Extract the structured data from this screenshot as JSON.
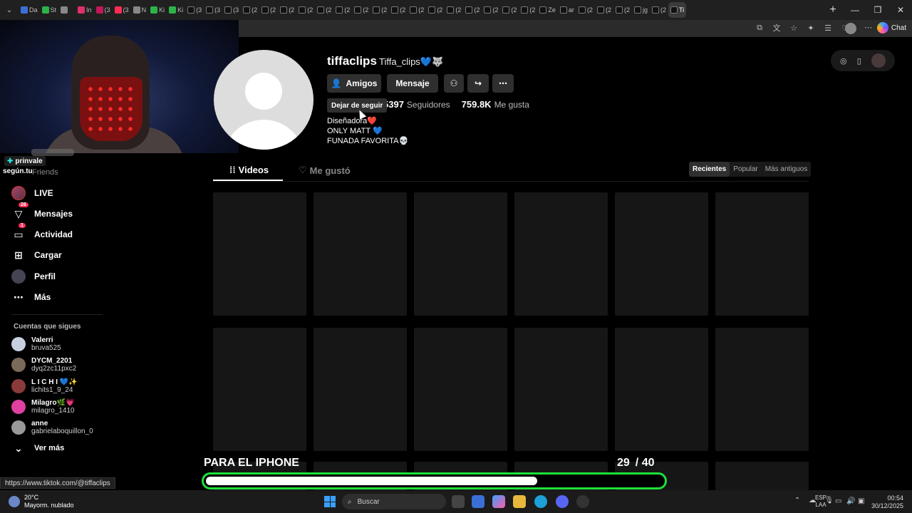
{
  "browser": {
    "tabs": [
      "Da",
      "St",
      "",
      "In",
      "(3",
      "(3",
      "N",
      "Ki",
      "Ki",
      "(3",
      "(3",
      "(3",
      "(2",
      "(2",
      "(2",
      "(2",
      "(2",
      "(2",
      "(2",
      "(2",
      "(2",
      "(2",
      "(2",
      "(2",
      "(2",
      "(2",
      "(2",
      "(2",
      "Ze",
      "ar",
      "(2",
      "(2",
      "(2",
      "jg",
      "(2",
      "Ti"
    ],
    "copilot_label": "Chat"
  },
  "sidebar": {
    "badge": "prinvale",
    "sub": "según.tu",
    "friends": "Friends",
    "items": [
      {
        "label": "LIVE",
        "icon": "live-avatar-icon"
      },
      {
        "label": "Mensajes",
        "icon": "messages-icon",
        "count": "26"
      },
      {
        "label": "Actividad",
        "icon": "activity-icon",
        "count": "1"
      },
      {
        "label": "Cargar",
        "icon": "upload-icon"
      },
      {
        "label": "Perfil",
        "icon": "profile-icon"
      },
      {
        "label": "Más",
        "icon": "more-icon"
      }
    ],
    "following_heading": "Cuentas que sigues",
    "accounts": [
      {
        "name": "Valerri",
        "handle": "bruva525",
        "color": "#c8d0e0"
      },
      {
        "name": "DYCM_2201",
        "handle": "dyq2zc11pxc2",
        "color": "#7a6a5a"
      },
      {
        "name": "L I C H I 💙✨",
        "handle": "lichits1_9_24",
        "color": "#8a3a3a"
      },
      {
        "name": "Milagro🌿💗",
        "handle": "milagro_1410",
        "color": "#e040a0"
      },
      {
        "name": "anne",
        "handle": "gabrielaboquillon_0",
        "color": "#999999"
      }
    ],
    "see_more": "Ver más"
  },
  "profile": {
    "username": "tiffaclips",
    "nickname": "Tiffa_clips💙🐺",
    "buttons": {
      "friends": "Amigos",
      "message": "Mensaje"
    },
    "tooltip": "Dejar de seguir",
    "followers_value": "5397",
    "followers_label": "Seguidores",
    "likes_value": "759.8K",
    "likes_label": "Me gusta",
    "bio": [
      "Diseñadora❤️",
      "ONLY MATT 💙",
      "FUNADA FAVORITA💀"
    ]
  },
  "tabs": {
    "videos": "Videos",
    "liked": "Me gustó"
  },
  "sort": {
    "recent": "Recientes",
    "popular": "Popular",
    "oldest": "Más antiguos"
  },
  "overlay": {
    "title": "PARA EL IPHONE",
    "current": "29",
    "total": "/ 40",
    "progress": 0.725
  },
  "status_url": "https://www.tiktok.com/@tiffaclips",
  "taskbar": {
    "temp": "20°C",
    "weather": "Mayorm. nublado",
    "search": "Buscar",
    "lang1": "ESP",
    "lang2": "LAA",
    "time": "00:54",
    "date": "30/12/2025"
  }
}
